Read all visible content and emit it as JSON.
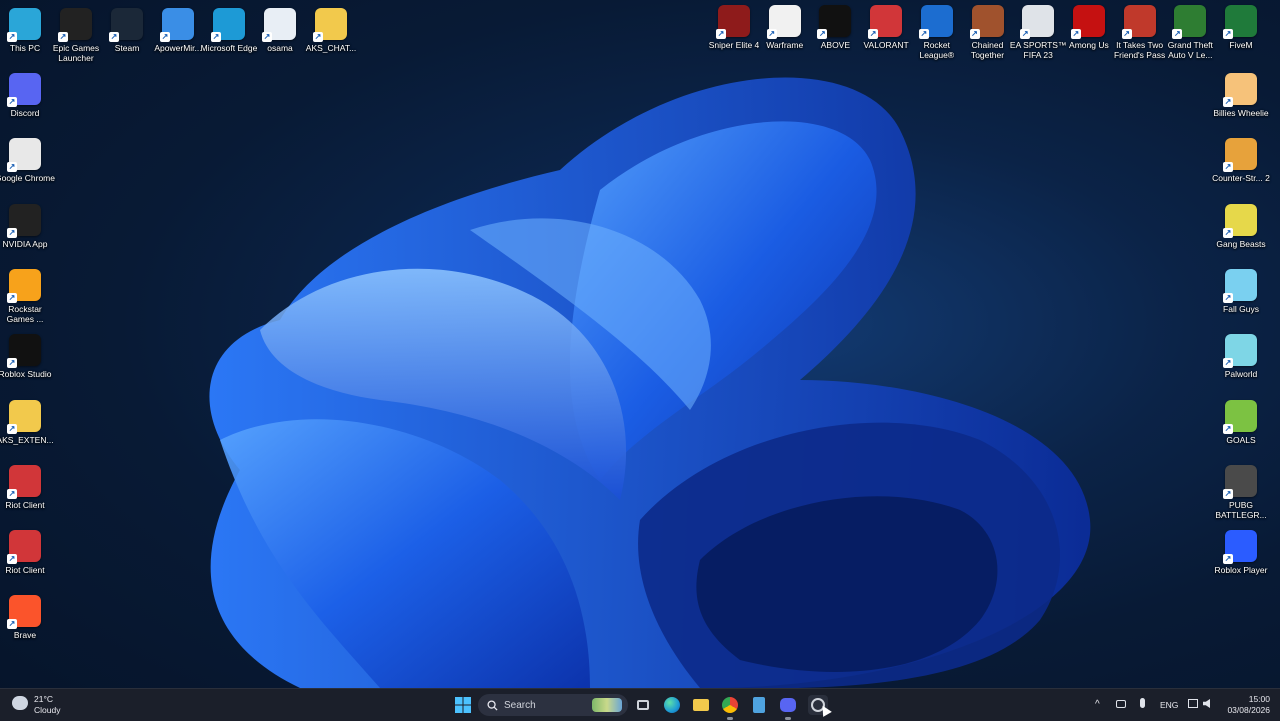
{
  "desktop_left": [
    {
      "label": "This PC",
      "icon": "monitor-icon",
      "color": "#2aa6d8"
    },
    {
      "label": "Epic Games Launcher",
      "icon": "epic-games-icon",
      "color": "#222222"
    },
    {
      "label": "Steam",
      "icon": "steam-icon",
      "color": "#1b2838"
    },
    {
      "label": "ApowerMir...",
      "icon": "apowermirror-icon",
      "color": "#3a8ee6"
    },
    {
      "label": "Microsoft Edge",
      "icon": "edge-icon",
      "color": "#1d9ad6"
    },
    {
      "label": "osama",
      "icon": "document-icon",
      "color": "#e8eef5"
    },
    {
      "label": "AKS_CHAT...",
      "icon": "folder-icon",
      "color": "#f2c94c"
    }
  ],
  "desktop_col1": [
    {
      "label": "Discord",
      "icon": "discord-icon",
      "color": "#5865f2"
    },
    {
      "label": "Google Chrome",
      "icon": "chrome-icon",
      "color": "#e8e8e8"
    },
    {
      "label": "NVIDIA App",
      "icon": "nvidia-icon",
      "color": "#222222"
    },
    {
      "label": "Rockstar Games ...",
      "icon": "rockstar-icon",
      "color": "#f7a21b"
    },
    {
      "label": "Roblox Studio",
      "icon": "roblox-studio-icon",
      "color": "#111111"
    },
    {
      "label": "AKS_EXTEN...",
      "icon": "folder-icon",
      "color": "#f2c94c"
    },
    {
      "label": "Riot Client",
      "icon": "riot-icon",
      "color": "#d13639"
    },
    {
      "label": "Riot Client",
      "icon": "riot-icon",
      "color": "#d13639"
    },
    {
      "label": "Brave",
      "icon": "brave-icon",
      "color": "#fb542b"
    }
  ],
  "desktop_top_right": [
    {
      "label": "Sniper Elite 4",
      "icon": "sniper-elite-icon",
      "color": "#8e1b1b"
    },
    {
      "label": "Warframe",
      "icon": "warframe-icon",
      "color": "#f1f1f1"
    },
    {
      "label": "ABOVE",
      "icon": "above-icon",
      "color": "#111111"
    },
    {
      "label": "VALORANT",
      "icon": "valorant-icon",
      "color": "#d13639"
    },
    {
      "label": "Rocket League®",
      "icon": "rocket-league-icon",
      "color": "#1c6dd0"
    },
    {
      "label": "Chained Together",
      "icon": "chained-together-icon",
      "color": "#a0522d"
    },
    {
      "label": "EA SPORTS™ FIFA 23",
      "icon": "fifa-icon",
      "color": "#dfe3e8"
    },
    {
      "label": "Among Us",
      "icon": "among-us-icon",
      "color": "#c51111"
    },
    {
      "label": "It Takes Two Friend's Pass",
      "icon": "it-takes-two-icon",
      "color": "#c0392b"
    },
    {
      "label": "Grand Theft Auto V Le...",
      "icon": "gta-icon",
      "color": "#2e7d32"
    },
    {
      "label": "FiveM",
      "icon": "fivem-icon",
      "color": "#1f7a3a"
    }
  ],
  "desktop_right_col": [
    {
      "label": "Billies Wheelie",
      "icon": "billies-wheelie-icon",
      "color": "#f6c27a"
    },
    {
      "label": "Counter-Str... 2",
      "icon": "counter-strike-icon",
      "color": "#e7a23b"
    },
    {
      "label": "Gang Beasts",
      "icon": "gang-beasts-icon",
      "color": "#e6d84a"
    },
    {
      "label": "Fall Guys",
      "icon": "fall-guys-icon",
      "color": "#7ad0f0"
    },
    {
      "label": "Palworld",
      "icon": "palworld-icon",
      "color": "#7ed6e6"
    },
    {
      "label": "GOALS",
      "icon": "goals-icon",
      "color": "#7cc242"
    },
    {
      "label": "PUBG BATTLEGR...",
      "icon": "pubg-icon",
      "color": "#4a4a4a"
    },
    {
      "label": "Roblox Player",
      "icon": "roblox-player-icon",
      "color": "#2b5cff"
    }
  ],
  "weather": {
    "temp": "21°C",
    "condition": "Cloudy"
  },
  "search": {
    "placeholder": "Search"
  },
  "tray": {
    "language": "ENG",
    "time": "15:00",
    "date": "03/08/2026"
  }
}
